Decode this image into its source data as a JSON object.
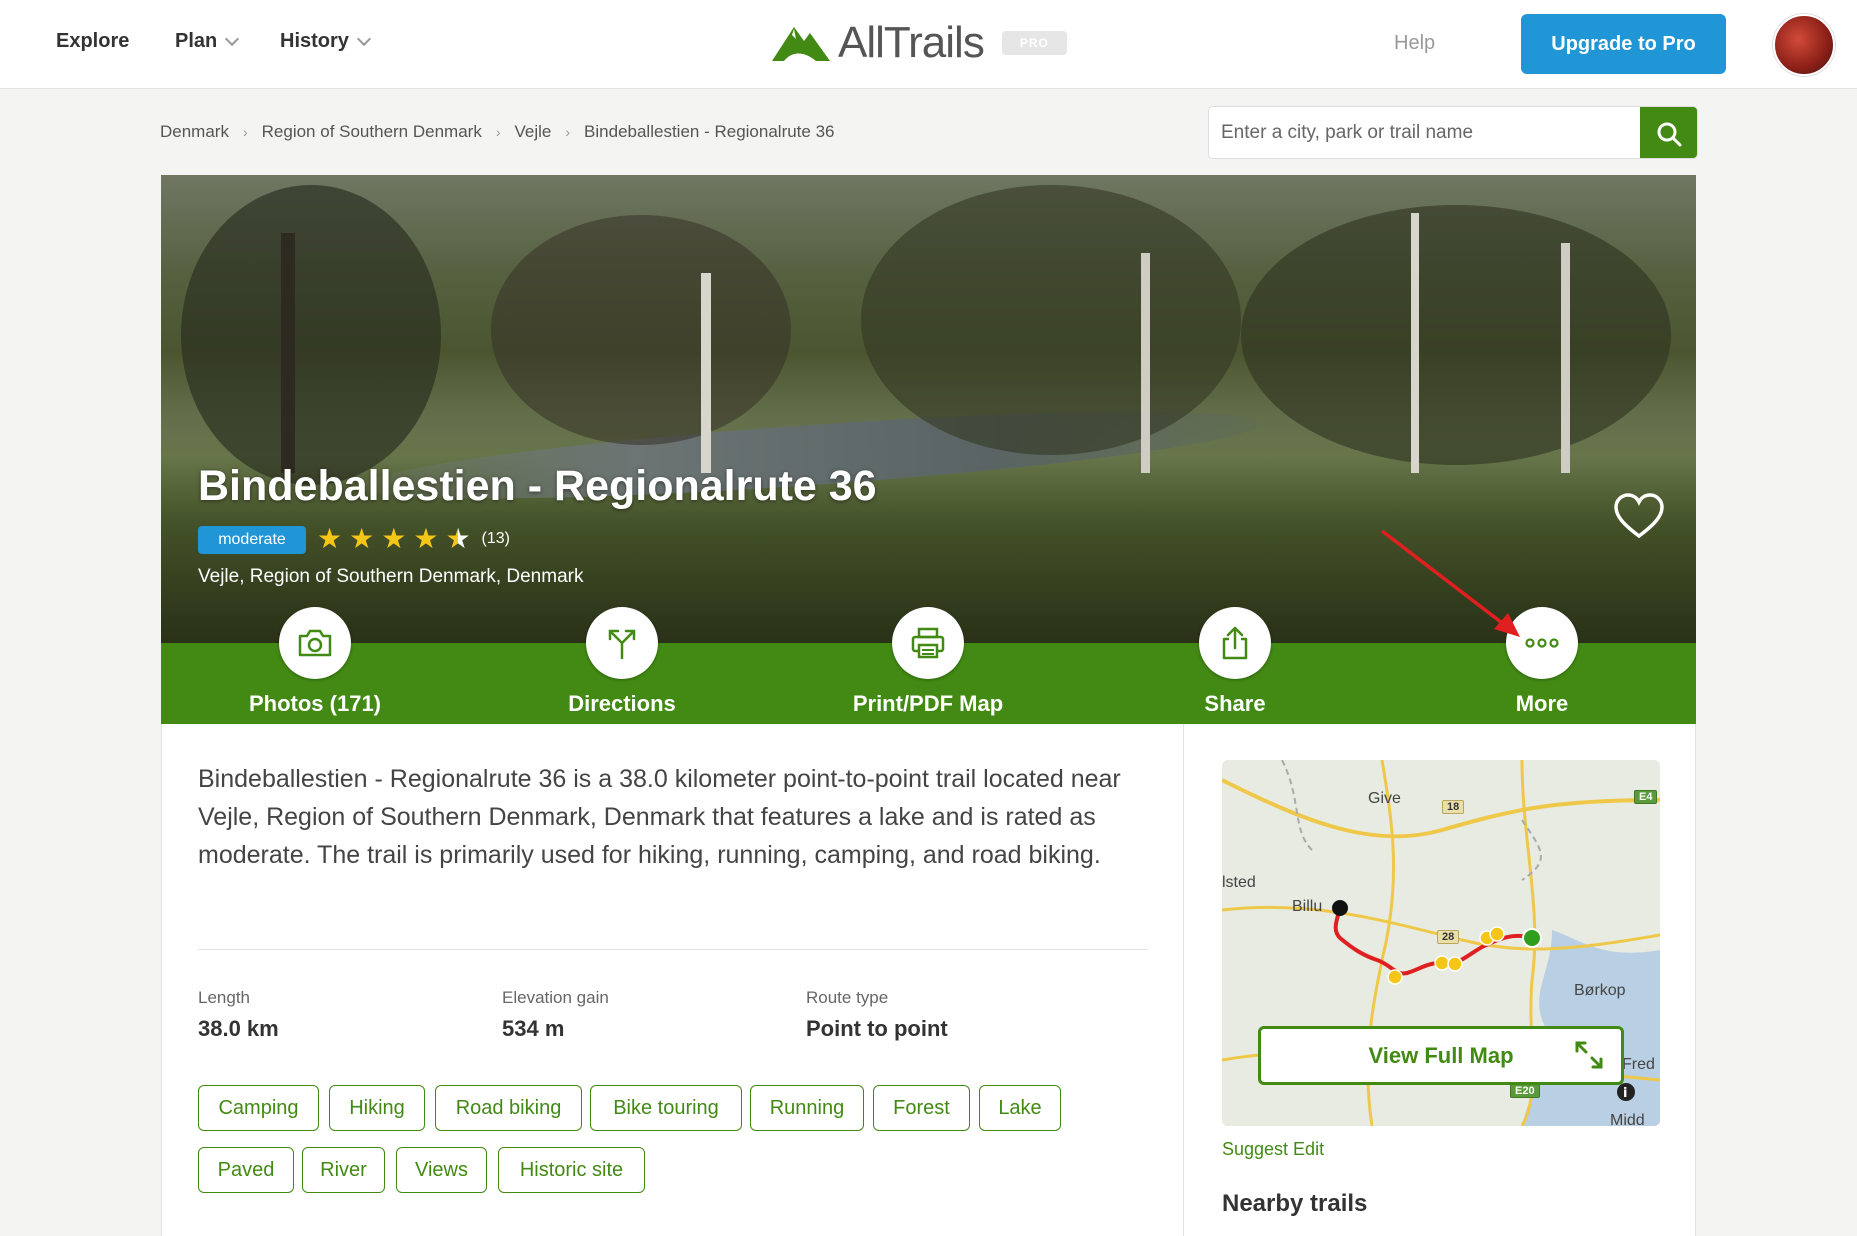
{
  "header": {
    "nav": [
      {
        "label": "Explore"
      },
      {
        "label": "Plan"
      },
      {
        "label": "History"
      }
    ],
    "logo_text": "AllTrails",
    "pro_badge": "PRO",
    "help": "Help",
    "upgrade": "Upgrade to Pro"
  },
  "breadcrumb": [
    "Denmark",
    "Region of Southern Denmark",
    "Vejle",
    "Bindeballestien - Regionalrute 36"
  ],
  "search": {
    "placeholder": "Enter a city, park or trail name",
    "value": ""
  },
  "trail": {
    "title": "Bindeballestien - Regionalrute 36",
    "difficulty": "moderate",
    "rating": 4.5,
    "review_count": "(13)",
    "location": "Vejle, Region of Southern Denmark, Denmark"
  },
  "actions": [
    {
      "label": "Photos (171)",
      "icon": "camera-icon"
    },
    {
      "label": "Directions",
      "icon": "directions-icon"
    },
    {
      "label": "Print/PDF Map",
      "icon": "printer-icon"
    },
    {
      "label": "Share",
      "icon": "share-icon"
    },
    {
      "label": "More",
      "icon": "more-icon"
    }
  ],
  "description": "Bindeballestien - Regionalrute 36 is a 38.0 kilometer point-to-point trail located near Vejle, Region of Southern Denmark, Denmark that features a lake and is rated as moderate. The trail is primarily used for hiking, running, camping, and road biking.",
  "stats": [
    {
      "label": "Length",
      "value": "38.0 km"
    },
    {
      "label": "Elevation gain",
      "value": "534 m"
    },
    {
      "label": "Route type",
      "value": "Point to point"
    }
  ],
  "tags": [
    "Camping",
    "Hiking",
    "Road biking",
    "Bike touring",
    "Running",
    "Forest",
    "Lake",
    "Paved",
    "River",
    "Views",
    "Historic site"
  ],
  "map": {
    "labels": [
      "Give",
      "lsted",
      "Billu",
      "Børkop",
      "Fred",
      "Midd"
    ],
    "road_badges": [
      "18",
      "28",
      "E20",
      "E4"
    ],
    "view_full_map": "View Full Map"
  },
  "suggest_edit": "Suggest Edit",
  "nearby_title": "Nearby trails",
  "colors": {
    "brand_green": "#428a13",
    "blue": "#2196d6",
    "star": "#f5c518"
  }
}
